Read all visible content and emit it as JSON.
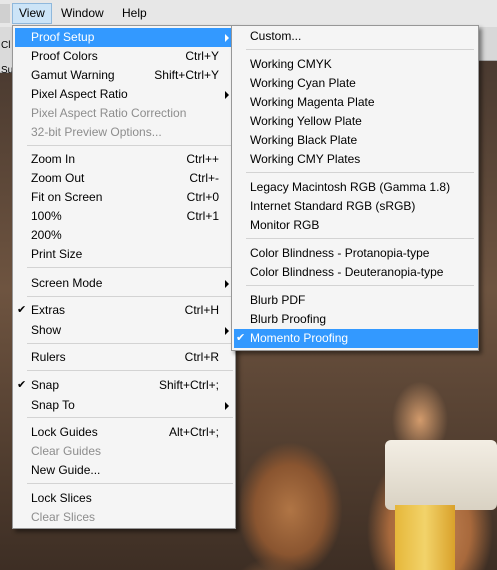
{
  "menubar": {
    "items": [
      "View",
      "Window",
      "Help"
    ]
  },
  "behind": {
    "strip_labels": [
      "Cl",
      "Su"
    ]
  },
  "view_menu": {
    "items": [
      {
        "label": "Proof Setup",
        "shortcut": "",
        "submenu": true,
        "selected": true
      },
      {
        "label": "Proof Colors",
        "shortcut": "Ctrl+Y"
      },
      {
        "label": "Gamut Warning",
        "shortcut": "Shift+Ctrl+Y"
      },
      {
        "label": "Pixel Aspect Ratio",
        "shortcut": "",
        "submenu": true
      },
      {
        "label": "Pixel Aspect Ratio Correction",
        "disabled": true
      },
      {
        "label": "32-bit Preview Options...",
        "disabled": true
      },
      {
        "label": "Zoom In",
        "shortcut": "Ctrl++"
      },
      {
        "label": "Zoom Out",
        "shortcut": "Ctrl+-"
      },
      {
        "label": "Fit on Screen",
        "shortcut": "Ctrl+0"
      },
      {
        "label": "100%",
        "shortcut": "Ctrl+1"
      },
      {
        "label": "200%",
        "shortcut": ""
      },
      {
        "label": "Print Size",
        "shortcut": ""
      },
      {
        "label": "Screen Mode",
        "submenu": true
      },
      {
        "label": "Extras",
        "shortcut": "Ctrl+H",
        "checked": true
      },
      {
        "label": "Show",
        "submenu": true
      },
      {
        "label": "Rulers",
        "shortcut": "Ctrl+R"
      },
      {
        "label": "Snap",
        "shortcut": "Shift+Ctrl+;",
        "checked": true
      },
      {
        "label": "Snap To",
        "submenu": true
      },
      {
        "label": "Lock Guides",
        "shortcut": "Alt+Ctrl+;"
      },
      {
        "label": "Clear Guides",
        "disabled": true
      },
      {
        "label": "New Guide..."
      },
      {
        "label": "Lock Slices"
      },
      {
        "label": "Clear Slices",
        "disabled": true
      }
    ]
  },
  "proof_menu": {
    "items": [
      {
        "label": "Custom..."
      },
      {
        "label": "Working CMYK"
      },
      {
        "label": "Working Cyan Plate"
      },
      {
        "label": "Working Magenta Plate"
      },
      {
        "label": "Working Yellow Plate"
      },
      {
        "label": "Working Black Plate"
      },
      {
        "label": "Working CMY Plates"
      },
      {
        "label": "Legacy Macintosh RGB (Gamma 1.8)"
      },
      {
        "label": "Internet Standard RGB (sRGB)"
      },
      {
        "label": "Monitor RGB"
      },
      {
        "label": "Color Blindness - Protanopia-type"
      },
      {
        "label": "Color Blindness - Deuteranopia-type"
      },
      {
        "label": "Blurb PDF"
      },
      {
        "label": "Blurb Proofing"
      },
      {
        "label": "Momento Proofing",
        "checked": true,
        "selected": true
      }
    ]
  },
  "check_glyph": "✔",
  "colors": {
    "highlight": "#3399ff",
    "disabled_text": "#8d8d8d"
  }
}
